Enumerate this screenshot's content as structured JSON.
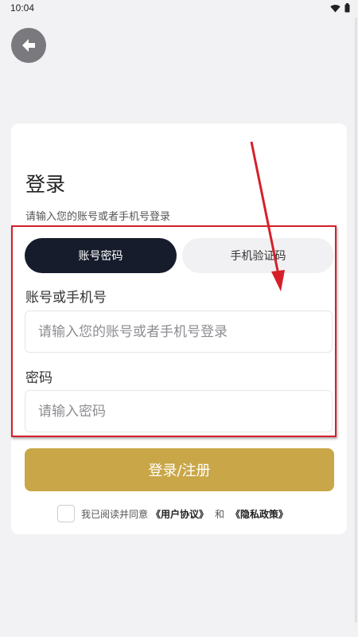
{
  "status_bar": {
    "time": "10:04"
  },
  "header": {
    "back_icon": "arrow-left-icon"
  },
  "login": {
    "title": "登录",
    "subtitle": "请输入您的账号或者手机号登录",
    "tabs": [
      {
        "label": "账号密码",
        "active": true
      },
      {
        "label": "手机验证码",
        "active": false
      }
    ],
    "account_label": "账号或手机号",
    "account_placeholder": "请输入您的账号或者手机号登录",
    "password_label": "密码",
    "password_placeholder": "请输入密码",
    "submit_label": "登录/注册",
    "agreement": {
      "prefix": "我已阅读并同意",
      "user_agreement": "《用户协议》",
      "and": "和",
      "privacy_policy": "《隐私政策》"
    }
  },
  "colors": {
    "background": "#f2f2f4",
    "active_tab": "#161c2c",
    "inactive_tab": "#f1f1f3",
    "primary_button": "#c9a748",
    "annotation": "#d5202a"
  }
}
